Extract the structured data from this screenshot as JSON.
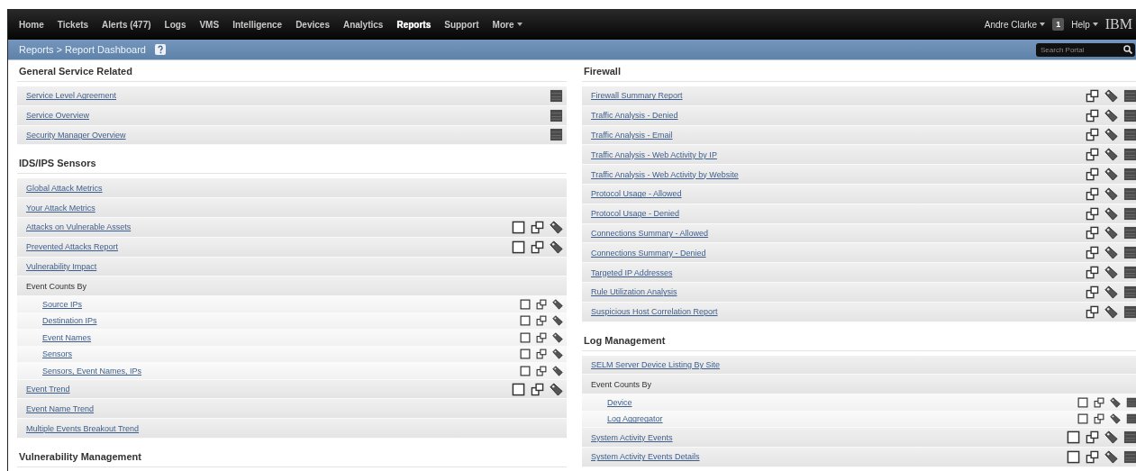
{
  "nav": {
    "items": [
      {
        "label": "Home",
        "selected": false
      },
      {
        "label": "Tickets",
        "selected": false
      },
      {
        "label": "Alerts (477)",
        "selected": false
      },
      {
        "label": "Logs",
        "selected": false
      },
      {
        "label": "VMS",
        "selected": false
      },
      {
        "label": "Intelligence",
        "selected": false
      },
      {
        "label": "Devices",
        "selected": false
      },
      {
        "label": "Analytics",
        "selected": false
      },
      {
        "label": "Reports",
        "selected": true
      },
      {
        "label": "Support",
        "selected": false
      },
      {
        "label": "More",
        "selected": false,
        "dropdown": true
      }
    ],
    "user": "Andre Clarke",
    "badge": "1",
    "help": "Help",
    "logo": "IBM"
  },
  "breadcrumb": {
    "path": "Reports > Report Dashboard",
    "search": {
      "placeholder": "Search Portal"
    }
  },
  "columns": [
    [
      {
        "title": "General Service Related",
        "rows": [
          {
            "label": "Service Level Agreement",
            "kind": "link",
            "report": true
          },
          {
            "label": "Service Overview",
            "kind": "link",
            "report": true
          },
          {
            "label": "Security Manager Overview",
            "kind": "link",
            "report": true
          }
        ]
      },
      {
        "title": "IDS/IPS Sensors",
        "rows": [
          {
            "label": "Global Attack Metrics",
            "kind": "link"
          },
          {
            "label": "Your Attack Metrics",
            "kind": "link"
          },
          {
            "label": "Attacks on Vulnerable Assets",
            "kind": "link",
            "checkbox": true,
            "popout": true,
            "tag": true
          },
          {
            "label": "Prevented Attacks Report",
            "kind": "link",
            "checkbox": true,
            "popout": true,
            "tag": true
          },
          {
            "label": "Vulnerability Impact",
            "kind": "link"
          },
          {
            "label": "Event Counts By",
            "kind": "group",
            "children": [
              {
                "label": "Source IPs",
                "kind": "link",
                "checkbox": true,
                "popout": true,
                "tag": true
              },
              {
                "label": "Destination IPs",
                "kind": "link",
                "checkbox": true,
                "popout": true,
                "tag": true
              },
              {
                "label": "Event Names",
                "kind": "link",
                "checkbox": true,
                "popout": true,
                "tag": true
              },
              {
                "label": "Sensors",
                "kind": "link",
                "checkbox": true,
                "popout": true,
                "tag": true
              },
              {
                "label": "Sensors, Event Names, IPs",
                "kind": "link",
                "checkbox": true,
                "popout": true,
                "tag": true
              }
            ]
          },
          {
            "label": "Event Trend",
            "kind": "link",
            "checkbox": true,
            "popout": true,
            "tag": true
          },
          {
            "label": "Event Name Trend",
            "kind": "link"
          },
          {
            "label": "Multiple Events Breakout Trend",
            "kind": "link"
          }
        ]
      },
      {
        "title": "Vulnerability Management"
      }
    ],
    [
      {
        "title": "Firewall",
        "rows": [
          {
            "label": "Firewall Summary Report",
            "kind": "link",
            "popout": true,
            "tag": true,
            "report": true
          },
          {
            "label": "Traffic Analysis - Denied",
            "kind": "link",
            "popout": true,
            "tag": true,
            "report": true
          },
          {
            "label": "Traffic Analysis - Email",
            "kind": "link",
            "popout": true,
            "tag": true,
            "report": true
          },
          {
            "label": "Traffic Analysis - Web Activity by IP",
            "kind": "link",
            "popout": true,
            "tag": true,
            "report": true
          },
          {
            "label": "Traffic Analysis - Web Activity by Website",
            "kind": "link",
            "popout": true,
            "tag": true,
            "report": true
          },
          {
            "label": "Protocol Usage - Allowed",
            "kind": "link",
            "popout": true,
            "tag": true,
            "report": true
          },
          {
            "label": "Protocol Usage - Denied",
            "kind": "link",
            "popout": true,
            "tag": true,
            "report": true
          },
          {
            "label": "Connections Summary - Allowed",
            "kind": "link",
            "popout": true,
            "tag": true,
            "report": true
          },
          {
            "label": "Connections Summary - Denied",
            "kind": "link",
            "popout": true,
            "tag": true,
            "report": true
          },
          {
            "label": "Targeted IP Addresses",
            "kind": "link",
            "popout": true,
            "tag": true,
            "report": true
          },
          {
            "label": "Rule Utilization Analysis",
            "kind": "link",
            "popout": true,
            "tag": true,
            "report": true
          },
          {
            "label": "Suspicious Host Correlation Report",
            "kind": "link",
            "popout": true,
            "tag": true,
            "report": true
          }
        ]
      },
      {
        "title": "Log Management",
        "rows": [
          {
            "label": "SELM Server Device Listing By Site",
            "kind": "link"
          },
          {
            "label": "Event Counts By",
            "kind": "group",
            "children": [
              {
                "label": "Device",
                "kind": "link",
                "checkbox": true,
                "popout": true,
                "tag": true,
                "report": true
              },
              {
                "label": "Log Aggregator",
                "kind": "link",
                "checkbox": true,
                "popout": true,
                "tag": true,
                "report": true
              }
            ]
          },
          {
            "label": "System Activity Events",
            "kind": "link",
            "checkbox": true,
            "popout": true,
            "tag": true,
            "report": true
          },
          {
            "label": "System Activity Events Details",
            "kind": "link",
            "checkbox": true,
            "popout": true,
            "tag": true,
            "report": true
          }
        ]
      }
    ]
  ]
}
